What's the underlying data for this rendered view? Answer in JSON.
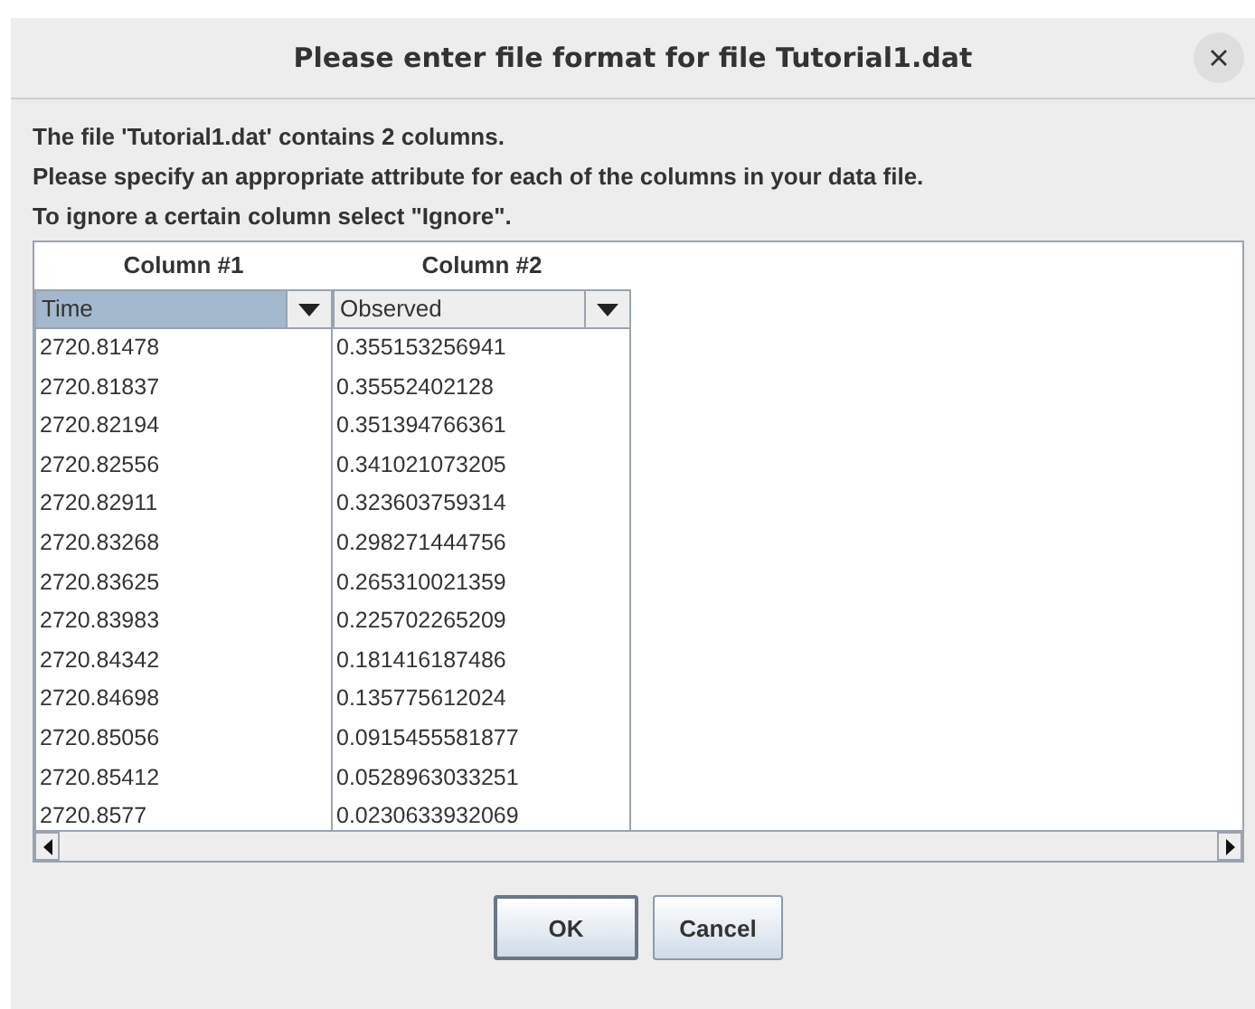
{
  "window": {
    "title": "Please enter file format for file Tutorial1.dat"
  },
  "message": [
    "The file 'Tutorial1.dat' contains 2 columns.",
    "Please specify an appropriate attribute for each of the columns in your data file.",
    "To ignore a certain column select \"Ignore\"."
  ],
  "columns": [
    {
      "heading": "Column #1",
      "attribute": "Time",
      "selected": true,
      "values": [
        "2720.81478",
        "2720.81837",
        "2720.82194",
        "2720.82556",
        "2720.82911",
        "2720.83268",
        "2720.83625",
        "2720.83983",
        "2720.84342",
        "2720.84698",
        "2720.85056",
        "2720.85412",
        "2720.8577"
      ]
    },
    {
      "heading": "Column #2",
      "attribute": "Observed",
      "selected": false,
      "values": [
        "0.355153256941",
        "0.35552402128",
        "0.351394766361",
        "0.341021073205",
        "0.323603759314",
        "0.298271444756",
        "0.265310021359",
        "0.225702265209",
        "0.181416187486",
        "0.135775612024",
        "0.0915455581877",
        "0.0528963033251",
        "0.0230633932069"
      ]
    }
  ],
  "buttons": [
    "OK",
    "Cancel"
  ]
}
